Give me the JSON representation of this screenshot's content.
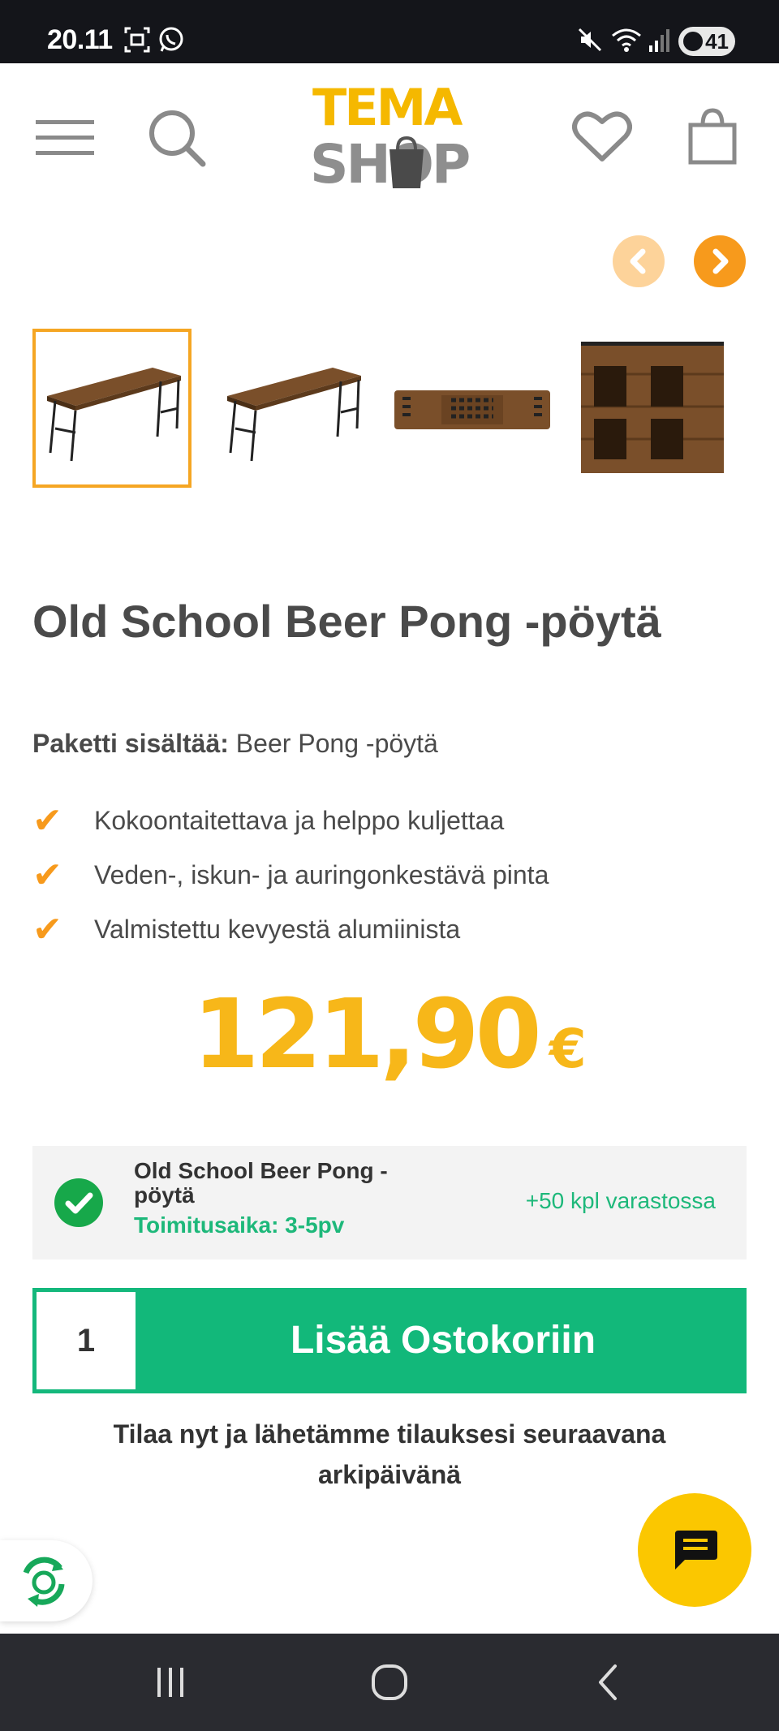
{
  "status_bar": {
    "time": "20.11",
    "battery": "41"
  },
  "header": {
    "logo_top": "TEMA",
    "logo_bottom": "SHOP"
  },
  "product": {
    "title": "Old School Beer Pong -pöytä",
    "package_label": "Paketti sisältää:",
    "package_value": " Beer Pong -pöytä",
    "features": [
      "Kokoontaitettava ja helppo kuljettaa",
      "Veden-, iskun- ja auringonkestävä pinta",
      "Valmistettu kevyestä alumiinista"
    ],
    "price": "121,90",
    "currency": "€"
  },
  "stock": {
    "name": "Old School Beer Pong -pöytä",
    "delivery": "Toimitusaika: 3-5pv",
    "quantity": "+50 kpl varastossa"
  },
  "cart": {
    "quantity": "1",
    "button_label": "Lisää Ostokoriin"
  },
  "shipping_note": "Tilaa nyt ja lähetämme tilauksesi seuraavana arkipäivänä",
  "colors": {
    "accent": "#f7b719",
    "arrow": "#f79a1c",
    "green": "#12b87a",
    "chat": "#fbc700"
  }
}
